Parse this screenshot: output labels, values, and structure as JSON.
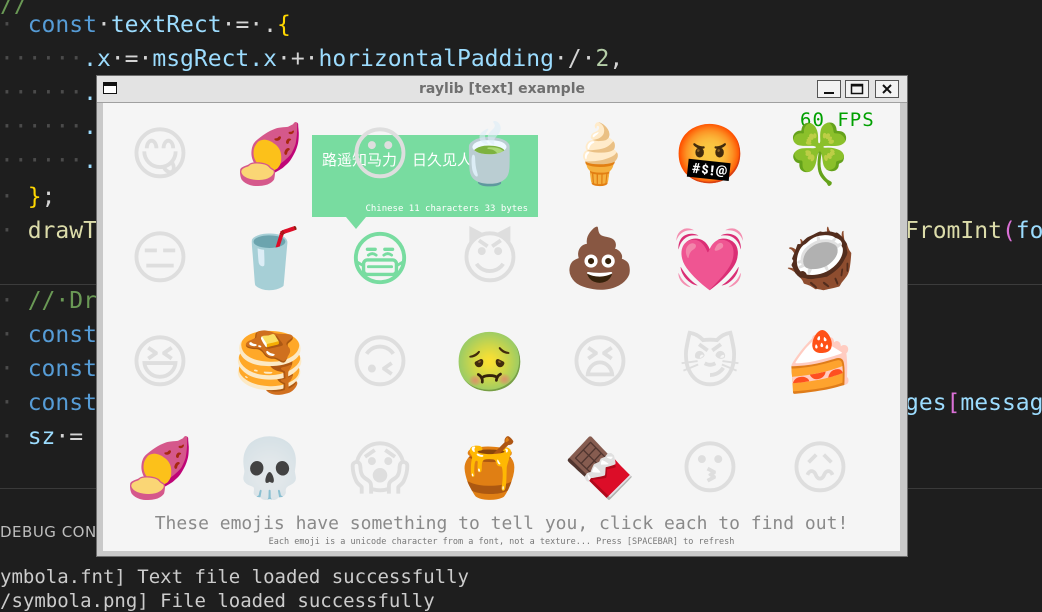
{
  "editor": {
    "lines": [
      {
        "ws": "",
        "parts": [
          {
            "c": "cmt",
            "t": "//"
          }
        ]
      },
      {
        "ws": "· ",
        "parts": [
          {
            "c": "kw",
            "t": "const"
          },
          {
            "c": "punc",
            "t": "·"
          },
          {
            "c": "var",
            "t": "textRect"
          },
          {
            "c": "punc",
            "t": "·=·."
          },
          {
            "c": "brace",
            "t": "{"
          }
        ]
      },
      {
        "ws": "······",
        "parts": [
          {
            "c": "var",
            "t": ".x"
          },
          {
            "c": "punc",
            "t": "·=·"
          },
          {
            "c": "var",
            "t": "msgRect.x"
          },
          {
            "c": "punc",
            "t": "·+·"
          },
          {
            "c": "var",
            "t": "horizontalPadding"
          },
          {
            "c": "punc",
            "t": "·/·"
          },
          {
            "c": "num",
            "t": "2"
          },
          {
            "c": "punc",
            "t": ","
          }
        ]
      },
      {
        "ws": "······",
        "parts": [
          {
            "c": "var",
            "t": "."
          }
        ]
      },
      {
        "ws": "······",
        "parts": [
          {
            "c": "var",
            "t": "."
          }
        ]
      },
      {
        "ws": "······",
        "parts": [
          {
            "c": "var",
            "t": "."
          }
        ]
      },
      {
        "ws": "· ",
        "parts": [
          {
            "c": "brace",
            "t": "}"
          },
          {
            "c": "punc",
            "t": ";"
          }
        ]
      },
      {
        "ws": "· ",
        "parts": [
          {
            "c": "fn",
            "t": "drawT"
          }
        ]
      },
      {
        "ws": "",
        "parts": []
      },
      {
        "ws": "· ",
        "parts": [
          {
            "c": "cmt",
            "t": "//·Dr"
          }
        ]
      },
      {
        "ws": "· ",
        "parts": [
          {
            "c": "kw",
            "t": "const"
          }
        ]
      },
      {
        "ws": "· ",
        "parts": [
          {
            "c": "kw",
            "t": "const"
          }
        ]
      },
      {
        "ws": "· ",
        "parts": [
          {
            "c": "kw",
            "t": "const"
          }
        ]
      },
      {
        "ws": "· ",
        "parts": [
          {
            "c": "var",
            "t": "sz"
          },
          {
            "c": "punc",
            "t": "·="
          }
        ]
      }
    ],
    "right_fragments": [
      {
        "line": 7,
        "parts": [
          {
            "c": "fn",
            "t": "FromInt"
          },
          {
            "c": "pink",
            "t": "("
          },
          {
            "c": "var",
            "t": "fo"
          }
        ]
      },
      {
        "line": 12,
        "parts": [
          {
            "c": "var",
            "t": "ges"
          },
          {
            "c": "pink",
            "t": "["
          },
          {
            "c": "var",
            "t": "messag"
          }
        ]
      }
    ],
    "panel_tab": "DEBUG CONSO",
    "panel_lines": [
      "ymbola.fnt] Text file loaded successfully",
      "/symbola.png] File loaded successfully"
    ]
  },
  "window": {
    "title": "raylib [text] example",
    "fps": "60 FPS",
    "bubble": {
      "text": "路遥知马力，日久见人心",
      "meta": "Chinese 11 characters 33 bytes"
    },
    "emojis": [
      "😋",
      "🍠",
      "😶",
      "🍵",
      "🍦",
      "🤬",
      "🍀",
      "😑",
      "🥤",
      "😷",
      "😈",
      "💩",
      "💓",
      "🥥",
      "😆",
      "🥞",
      "🙃",
      "🤢",
      "😫",
      "😼",
      "🍰",
      "🍠",
      "💀",
      "😱",
      "🍯",
      "🍫",
      "😗",
      "😖"
    ],
    "selected_index": 9,
    "footer_main": "These emojis have something to tell you, click each to find out!",
    "footer_sub": "Each emoji is a unicode character from a font, not a texture... Press [SPACEBAR] to refresh",
    "colors": {
      "accent": "#78dca0",
      "emoji": "#dedede",
      "fps": "#00a000"
    }
  }
}
